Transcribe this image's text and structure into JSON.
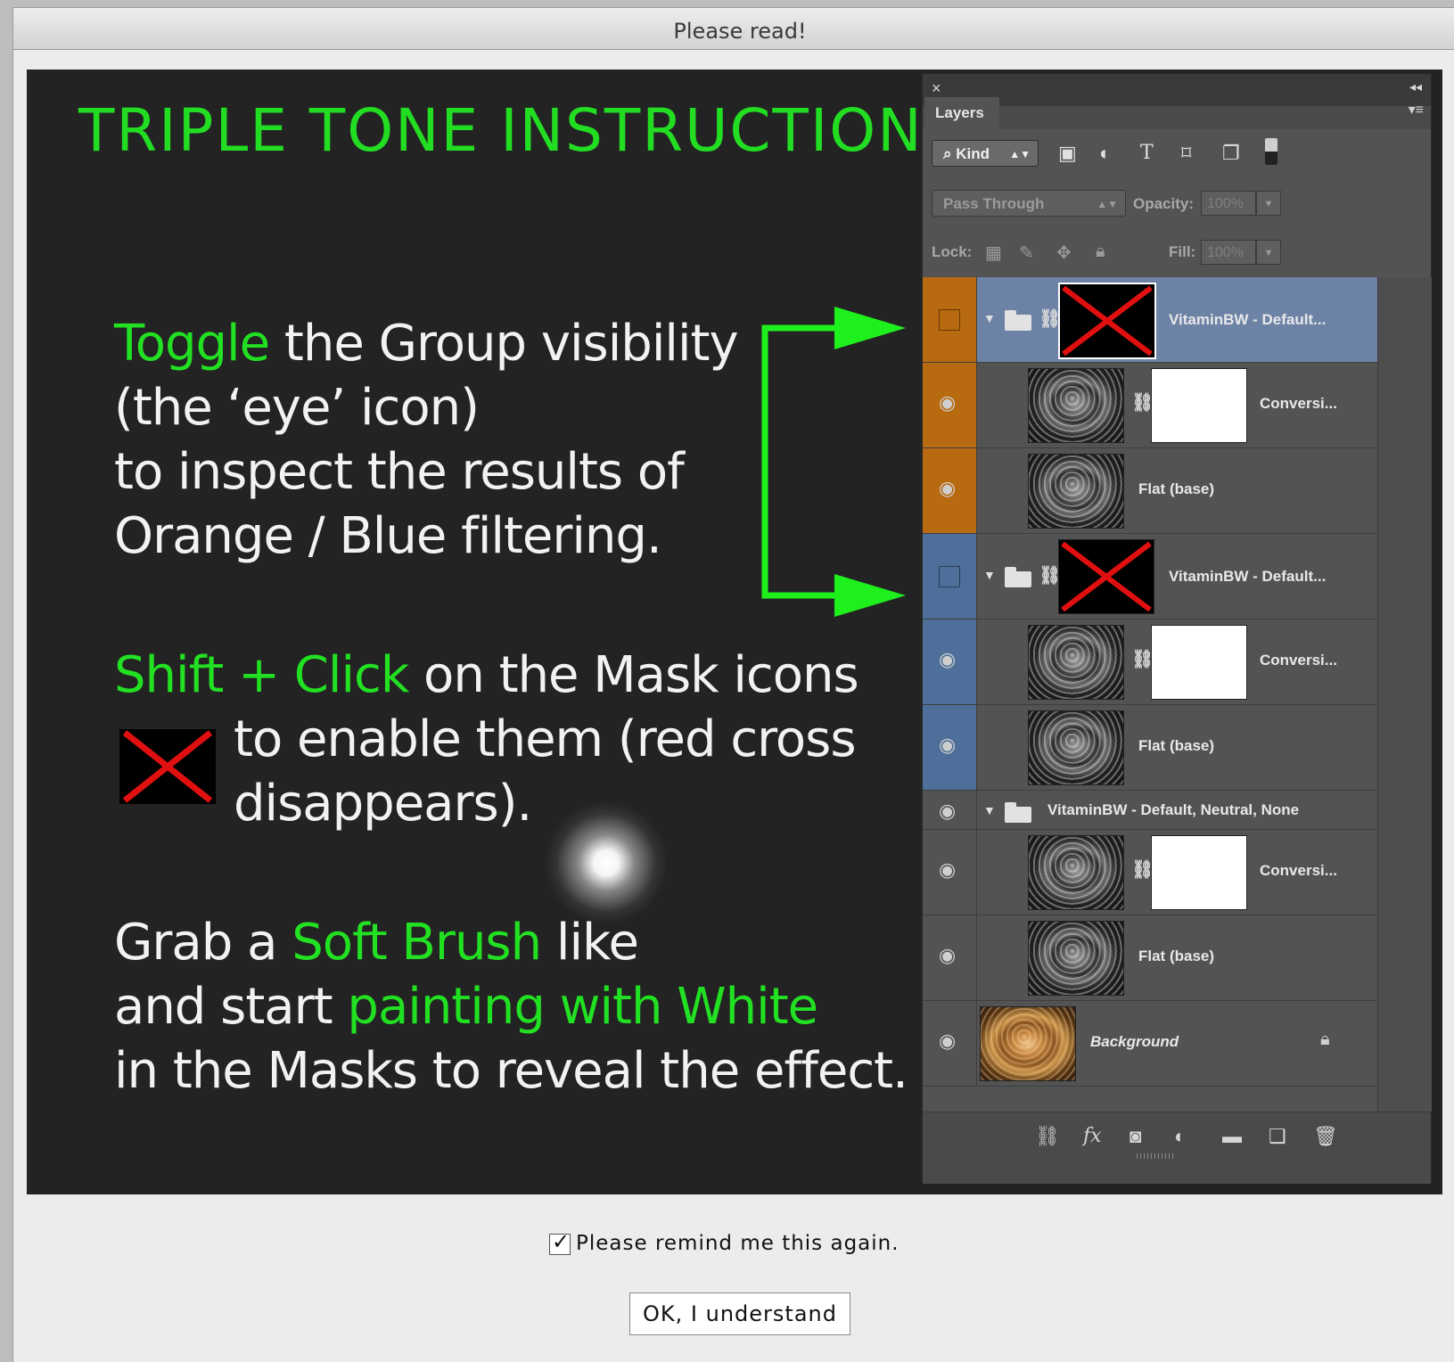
{
  "window": {
    "title": "Please read!"
  },
  "instructions": {
    "heading": "TRIPLE TONE INSTRUCTION",
    "block1": {
      "highlight": "Toggle",
      "line1_rest": " the Group visibility",
      "line2": "(the ‘eye’ icon)",
      "line3": "to inspect the results of",
      "line4": "Orange / Blue filtering."
    },
    "block2": {
      "highlight": "Shift + Click",
      "line1_rest": " on the Mask icons",
      "line2": "to enable them (red cross",
      "line3": "disappears)."
    },
    "block3": {
      "line1_a": "Grab a ",
      "line1_hl": "Soft Brush",
      "line1_b": " like",
      "line2_a": "and start ",
      "line2_hl": "painting with White",
      "line3": "in the Masks to reveal the effect."
    }
  },
  "layers_panel": {
    "close": "×",
    "collapse": "◂◂",
    "tab": "Layers",
    "menu": "▾≡",
    "filter_kind": "Kind",
    "blend_mode": "Pass Through",
    "opacity_label": "Opacity:",
    "opacity_value": "100%",
    "lock_label": "Lock:",
    "fill_label": "Fill:",
    "fill_value": "100%",
    "colors": {
      "orange": "#b86a10",
      "blue": "#4d6f9a",
      "selected": "#6d83a6"
    },
    "layers": [
      {
        "name": "VitaminBW - Default...",
        "kind": "group"
      },
      {
        "name": "Conversi...",
        "kind": "adjust"
      },
      {
        "name": "Flat (base)",
        "kind": "pixel"
      },
      {
        "name": "VitaminBW - Default...",
        "kind": "group"
      },
      {
        "name": "Conversi...",
        "kind": "adjust"
      },
      {
        "name": "Flat (base)",
        "kind": "pixel"
      },
      {
        "name": "VitaminBW - Default, Neutral, None",
        "kind": "group"
      },
      {
        "name": "Conversi...",
        "kind": "adjust"
      },
      {
        "name": "Flat (base)",
        "kind": "pixel"
      },
      {
        "name": "Background",
        "kind": "background"
      }
    ]
  },
  "footer": {
    "remind_label": "Please remind me this again.",
    "remind_checked": true,
    "ok_label": "OK, I understand"
  }
}
